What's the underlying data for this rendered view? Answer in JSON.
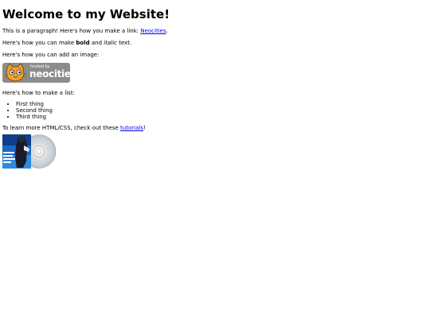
{
  "heading": "Welcome to my Website!",
  "intro": {
    "text": "This is a paragraph! Here's how you make a link: ",
    "link": "Neocities",
    "end": "."
  },
  "formatting": {
    "before": "Here's how you can make ",
    "bold": "bold",
    "middle": " and ",
    "italic": "italic",
    "after": " text."
  },
  "image_intro": "Here's how you can add an image:",
  "badge": {
    "small_text": "hosted by",
    "brand_text": "neocities",
    "icon": "neocities-cat-icon"
  },
  "list_intro": "Here's how to make a list:",
  "list_items": [
    "First thing",
    "Second thing",
    "Third thing"
  ],
  "learn": {
    "before": "To learn more HTML/CSS, check out these ",
    "link": "tutorials",
    "after": "!"
  },
  "album_icon": "cd-album-art-icon",
  "colors": {
    "link": "#0000ee",
    "badge_bg": "#8c8c8c"
  }
}
